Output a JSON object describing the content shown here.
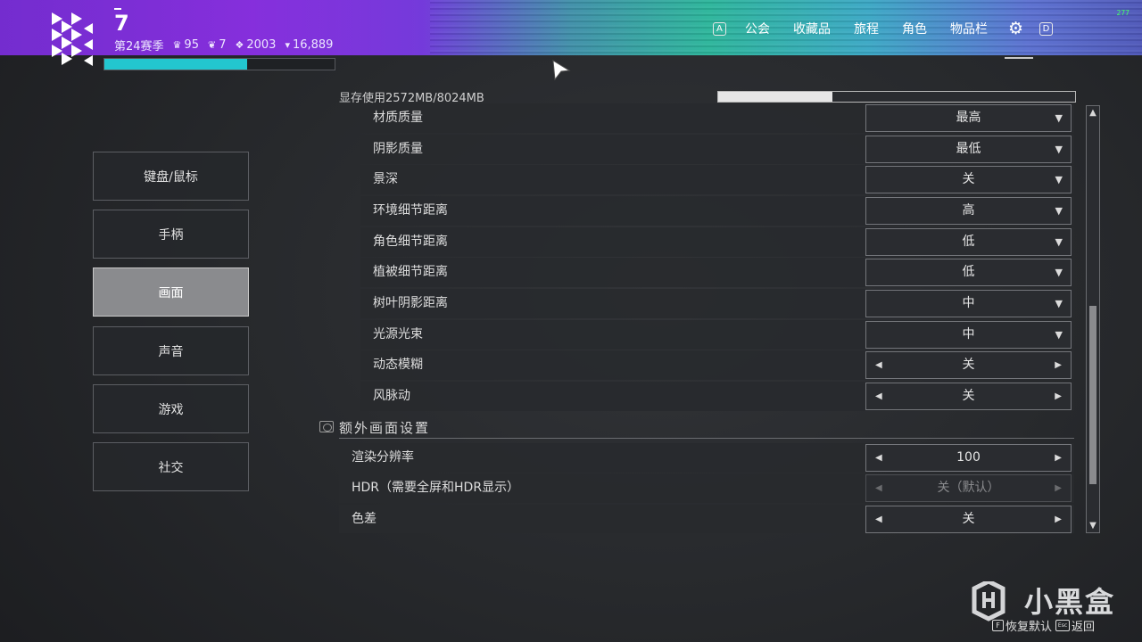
{
  "header": {
    "power": "7",
    "season": "第24赛季",
    "stats": [
      {
        "icon": "trophy-icon",
        "glyph": "♛",
        "value": "95"
      },
      {
        "icon": "rank-icon",
        "glyph": "❦",
        "value": "7"
      },
      {
        "icon": "glimmer-icon",
        "glyph": "❖",
        "value": "2003"
      },
      {
        "icon": "bright-dust-icon",
        "glyph": "▾",
        "value": "16,889"
      }
    ],
    "xp_progress": 0.62,
    "fps": "277"
  },
  "nav": {
    "key_left": "A",
    "items": [
      "公会",
      "收藏品",
      "旅程",
      "角色",
      "物品栏"
    ],
    "key_right": "D",
    "settings_icon": "gear-icon"
  },
  "side_menu": [
    {
      "label": "键盘/鼠标",
      "active": false
    },
    {
      "label": "手柄",
      "active": false
    },
    {
      "label": "画面",
      "active": true
    },
    {
      "label": "声音",
      "active": false
    },
    {
      "label": "游戏",
      "active": false
    },
    {
      "label": "社交",
      "active": false
    }
  ],
  "vram": {
    "label": "显存使用2572MB/8024MB",
    "fraction": 0.32
  },
  "settings": [
    {
      "label": "材质质量",
      "value": "最高",
      "control": "dropdown"
    },
    {
      "label": "阴影质量",
      "value": "最低",
      "control": "dropdown"
    },
    {
      "label": "景深",
      "value": "关",
      "control": "dropdown"
    },
    {
      "label": "环境细节距离",
      "value": "高",
      "control": "dropdown"
    },
    {
      "label": "角色细节距离",
      "value": "低",
      "control": "dropdown"
    },
    {
      "label": "植被细节距离",
      "value": "低",
      "control": "dropdown"
    },
    {
      "label": "树叶阴影距离",
      "value": "中",
      "control": "dropdown"
    },
    {
      "label": "光源光束",
      "value": "中",
      "control": "dropdown"
    },
    {
      "label": "动态模糊",
      "value": "关",
      "control": "stepper"
    },
    {
      "label": "风脉动",
      "value": "关",
      "control": "stepper"
    }
  ],
  "extra_section": {
    "title": "额外画面设置",
    "settings": [
      {
        "label": "渲染分辨率",
        "value": "100",
        "control": "stepper",
        "disabled": false
      },
      {
        "label": "HDR（需要全屏和HDR显示）",
        "value": "关（默认）",
        "control": "stepper",
        "disabled": true
      },
      {
        "label": "色差",
        "value": "关",
        "control": "stepper",
        "disabled": false
      }
    ]
  },
  "footer": {
    "watermark": "小黑盒",
    "actions": [
      {
        "key": "F",
        "label": "恢复默认"
      },
      {
        "key": "Esc",
        "label": "返回"
      }
    ]
  }
}
